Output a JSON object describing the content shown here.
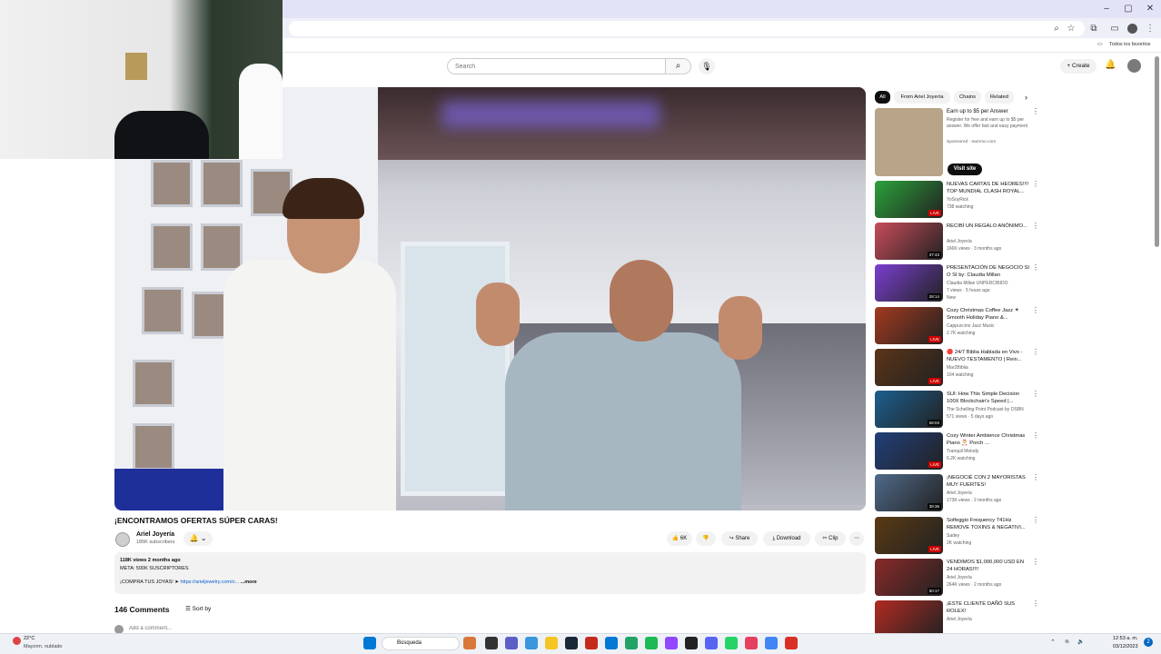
{
  "browser": {
    "bookmark_label": "Todos los favoritos",
    "window_controls": [
      "–",
      "▢",
      "✕"
    ]
  },
  "header": {
    "search_placeholder": "Search",
    "create_label": "+ Create"
  },
  "video": {
    "title": "¡ENCONTRAMOS OFERTAS SÚPER CARAS!",
    "channel": "Ariel Joyería",
    "subscribers": "185K subscribers",
    "likes": "6K",
    "share_label": "Share",
    "download_label": "Download",
    "clip_label": "Clip",
    "description": {
      "stats": "118K views  2 months ago",
      "line1": "META: 500K SUSCRIPTORES",
      "line2_prefix": "¡COMPRA TUS JOYAS! ➤",
      "line2_link": "https://arieljewelry.com/o...",
      "more": "...more"
    }
  },
  "comments": {
    "count": "146 Comments",
    "sort_label": "Sort by",
    "add_placeholder": "Add a comment..."
  },
  "sidebar": {
    "chips": [
      "All",
      "From Ariel Joyería",
      "Chains",
      "Related"
    ],
    "ad": {
      "title": "Earn up to $5 per Answer",
      "desc": "Register for free and earn up to $5 per answer. We offer fast and easy payment",
      "sponsor": "Sponsored · earnmo.com",
      "cta": "Visit site"
    },
    "items": [
      {
        "title": "NUEVAS CARTAS DE HEORES!!!! TOP MUNDIAL CLASH ROYAL...",
        "channel": "YoSoyRick",
        "meta": "738 watching",
        "badge": "LIVE",
        "thumb": "#2ba23b"
      },
      {
        "title": "RECIBÍ UN REGALO ANÓNIMO...",
        "channel": "Ariel Joyería",
        "meta": "166K views · 3 months ago",
        "badge": "37:43",
        "thumb": "#c84c5a"
      },
      {
        "title": "PRESENTACIÓN DE NEGOCIO SI O SI by: Claudia Millan",
        "channel": "Claudia Millan UNPERCIBIDO",
        "meta": "7 views · 5 hours ago",
        "extra": "New",
        "badge": "28:14",
        "thumb": "#7a3fd0"
      },
      {
        "title": "Cozy Christmas Coffee Jazz ☀ Smooth Holiday Piano &...",
        "channel": "Cappuccino Jazz Music",
        "meta": "2.7K watching",
        "badge": "LIVE",
        "thumb": "#a33a1e"
      },
      {
        "title": "🔴 24/7 Biblia Hablada en Vivo - NUEVO TESTAMENTO | Rein...",
        "channel": "Mar2Biblia",
        "meta": "104 watching",
        "badge": "LIVE",
        "thumb": "#5b3418"
      },
      {
        "title": "SUI: How This Simple Decision 100X Blockchain's Speed |...",
        "channel": "The Schelling Point Podcast by OSBN",
        "meta": "571 views · 5 days ago",
        "badge": "58:03",
        "thumb": "#1c5f8e"
      },
      {
        "title": "Cozy Winter Ambience Christmas Piano 🎅 Porch ...",
        "channel": "Tranquil Melody",
        "meta": "6.2K watching",
        "badge": "LIVE",
        "thumb": "#213f7a"
      },
      {
        "title": "¡NEGOCIÉ CON 2 MAYORISTAS MUY FUERTES!",
        "channel": "Ariel Joyería",
        "meta": "173K views · 2 months ago",
        "badge": "38:36",
        "thumb": "#4f6a8a"
      },
      {
        "title": "Solfeggio Frequency 741Hz REMOVE TOXINS & NEGATIVI...",
        "channel": "Sadey",
        "meta": "2K watching",
        "badge": "LIVE",
        "thumb": "#5a3a14"
      },
      {
        "title": "VENDIMOS $1,000,000 USD EN 24 HORAS!!!!",
        "channel": "Ariel Joyería",
        "meta": "264K views · 2 months ago",
        "badge": "50:17",
        "thumb": "#8a2a2a"
      },
      {
        "title": "¡ESTE CLIENTE DAÑÓ SUS ROLEX!",
        "channel": "Ariel Joyería",
        "meta": "",
        "badge": "",
        "thumb": "#b22a22"
      }
    ]
  },
  "taskbar": {
    "temp": "22°C",
    "weather": "Mayorm. nublado",
    "search_label": "Búsqueda",
    "time": "12:53 a. m.",
    "date": "03/12/2023"
  }
}
